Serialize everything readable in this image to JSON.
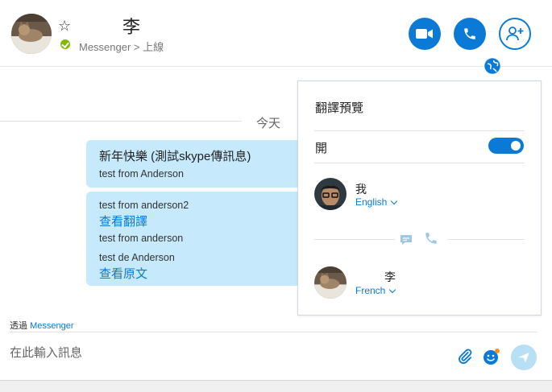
{
  "header": {
    "contact_name": "李",
    "status": "Messenger > 上線",
    "icons": [
      "favorite-star-icon",
      "video-call-icon",
      "audio-call-icon",
      "add-people-icon",
      "translator-icon"
    ]
  },
  "chat": {
    "date_label": "今天",
    "bubbles": [
      {
        "lines": [
          "新年快樂 (測試skype傳訊息)",
          "test from Anderson"
        ]
      },
      {
        "lines": [
          "test from anderson2",
          "查看翻譯",
          "test from anderson",
          "test de Anderson",
          "查看原文"
        ]
      }
    ]
  },
  "footer": {
    "via_prefix": "透過",
    "via_service": "Messenger",
    "input_placeholder": "在此輸入訊息"
  },
  "translator_panel": {
    "title": "翻譯預覽",
    "toggle_label": "開",
    "toggle_on": true,
    "me": {
      "name": "我",
      "language": "English"
    },
    "contact": {
      "name": "李",
      "language": "French"
    }
  },
  "colors": {
    "accent": "#0a7ad6",
    "bubble": "#c6e9fb",
    "online": "#7fba00"
  }
}
